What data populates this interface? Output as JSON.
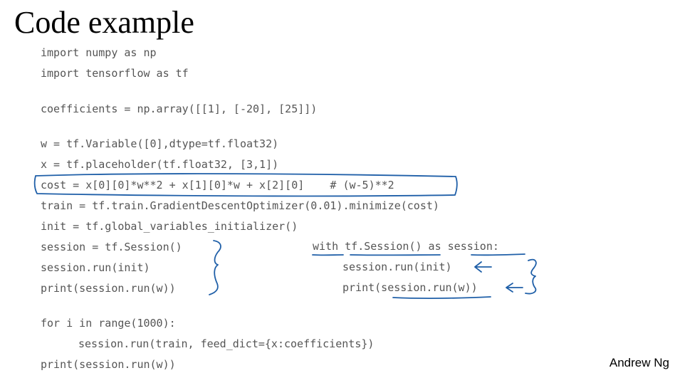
{
  "slide": {
    "title": "Code example",
    "author": "Andrew Ng"
  },
  "code": {
    "lines": [
      "import numpy as np",
      "import tensorflow as tf",
      "coefficients = np.array([[1], [-20], [25]])",
      "w = tf.Variable([0],dtype=tf.float32)",
      "x = tf.placeholder(tf.float32, [3,1])",
      "cost = x[0][0]*w**2 + x[1][0]*w + x[2][0]    # (w-5)**2",
      "train = tf.train.GradientDescentOptimizer(0.01).minimize(cost)",
      "init = tf.global_variables_initializer()",
      "session = tf.Session()",
      "session.run(init)",
      "print(session.run(w))",
      "for i in range(1000):",
      "session.run(train, feed_dict={x:coefficients})",
      "print(session.run(w))"
    ],
    "alt_block": [
      "with tf.Session() as session:",
      "session.run(init)",
      "print(session.run(w))"
    ]
  },
  "annotation_color": "#1f5fa8"
}
